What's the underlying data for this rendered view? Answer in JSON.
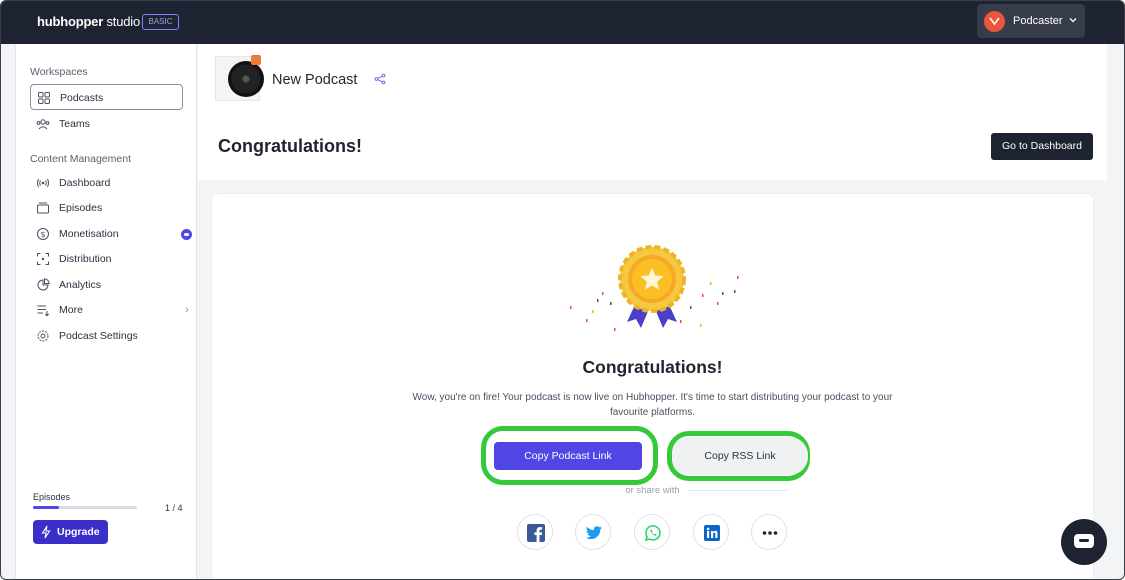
{
  "app": {
    "logo_bold": "hubhopper",
    "logo_light": " studio",
    "plan_badge": "BASIC",
    "user_name": "Podcaster"
  },
  "sidebar": {
    "workspaces_title": "Workspaces",
    "workspaces": [
      {
        "label": "Podcasts",
        "icon": "grid-icon",
        "active": true
      },
      {
        "label": "Teams",
        "icon": "people-icon"
      }
    ],
    "content_title": "Content Management",
    "content_items": [
      {
        "label": "Dashboard",
        "icon": "broadcast-icon"
      },
      {
        "label": "Episodes",
        "icon": "episodes-icon"
      },
      {
        "label": "Monetisation",
        "icon": "dollar-icon"
      },
      {
        "label": "Distribution",
        "icon": "expand-icon"
      },
      {
        "label": "Analytics",
        "icon": "pie-chart-icon"
      },
      {
        "label": "More",
        "icon": "list-icon"
      },
      {
        "label": "Podcast Settings",
        "icon": "gear-icon"
      }
    ],
    "episodes_label": "Episodes",
    "episodes_count": "1 / 4",
    "episodes_fraction": 0.25,
    "upgrade_label": "Upgrade"
  },
  "header": {
    "podcast_name": "New Podcast",
    "page_title": "Congratulations!",
    "dashboard_button": "Go to Dashboard"
  },
  "card": {
    "title": "Congratulations!",
    "description": "Wow, you're on fire! Your podcast is now live on Hubhopper. It's time to start distributing your podcast to your favourite platforms.",
    "copy_podcast_link": "Copy Podcast Link",
    "copy_rss_link": "Copy RSS Link",
    "share_with": "or share with",
    "social": [
      "facebook-icon",
      "twitter-icon",
      "whatsapp-icon",
      "linkedin-icon",
      "more-icon"
    ]
  },
  "colors": {
    "accent": "#4f46e5",
    "topbar": "#1d2330",
    "highlight": "#35c93a"
  }
}
